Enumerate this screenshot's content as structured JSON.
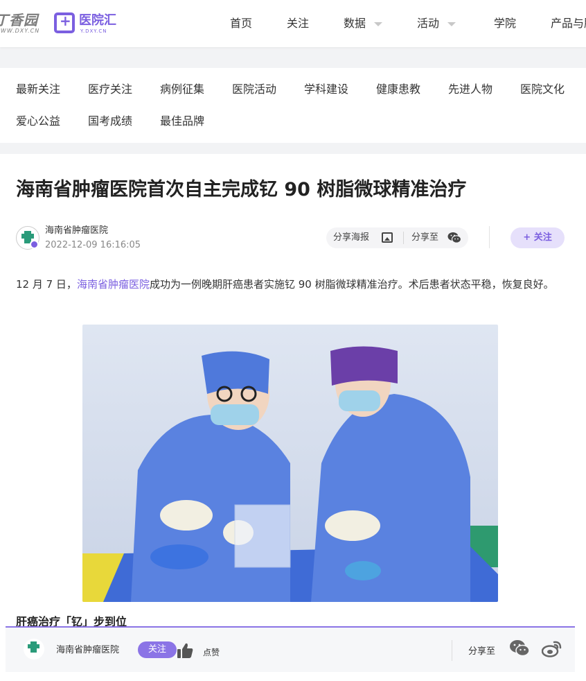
{
  "header": {
    "logo_dxy": {
      "text": "丁香园",
      "sub": "WWW.DXY.CN"
    },
    "logo_yyh": {
      "text": "医院汇",
      "sub": "Y.DXY.CN"
    },
    "nav": [
      "首页",
      "关注",
      "数据",
      "活动",
      "学院",
      "产品与服务"
    ]
  },
  "categories": [
    "最新关注",
    "医疗关注",
    "病例征集",
    "医院活动",
    "学科建设",
    "健康患教",
    "先进人物",
    "医院文化",
    "爱心公益",
    "国考成绩",
    "最佳品牌"
  ],
  "article": {
    "title": "海南省肿瘤医院首次自主完成钇 90 树脂微球精准治疗",
    "author": "海南省肿瘤医院",
    "date": "2022-12-09 16:16:05",
    "share_poster": "分享海报",
    "share_to": "分享至",
    "follow": "+ 关注",
    "para_prefix": "12 月 7 日，",
    "para_link": "海南省肿瘤医院",
    "para_suffix": "成功为一例晚期肝癌患者实施钇 90 树脂微球精准治疗。术后患者状态平稳，恢复良好。",
    "subheading": "肝癌治疗「钇」步到位"
  },
  "bottom_bar": {
    "author": "海南省肿瘤医院",
    "follow": "关注",
    "like": "点赞",
    "share_to": "分享至"
  },
  "colors": {
    "accent": "#7b5fe0",
    "accent_light": "#e6e0fb"
  },
  "icons": [
    "image-icon",
    "wechat-icon",
    "thumbs-up-icon",
    "weibo-icon",
    "chevron-down-icon"
  ]
}
